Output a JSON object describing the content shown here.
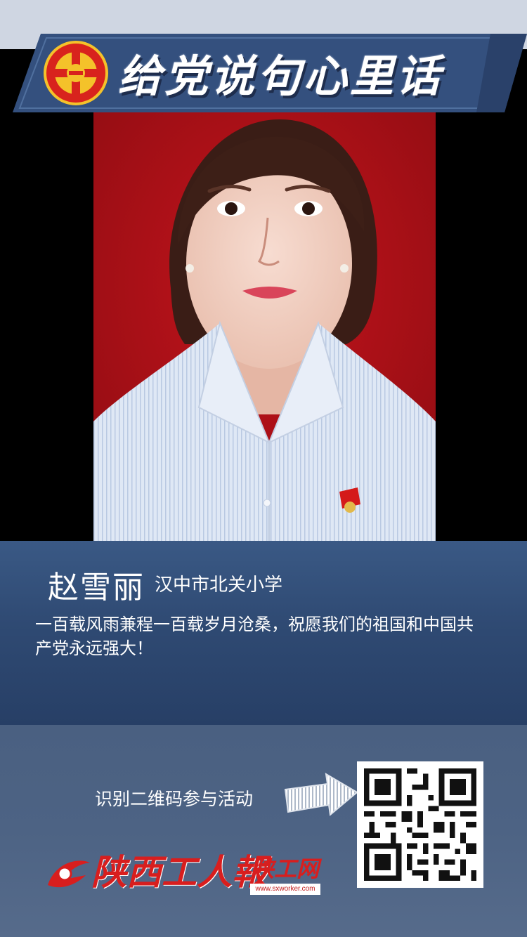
{
  "banner": {
    "title": "给党说句心里话",
    "emblem": "trade-union-emblem"
  },
  "person": {
    "name": "赵雪丽",
    "organization": "汉中市北关小学",
    "message": "一百载风雨兼程一百载岁月沧桑，祝愿我们的祖国和中国共产党永远强大！"
  },
  "footer": {
    "cta": "识别二维码参与活动",
    "newspaper": "陕西工人報",
    "website": "陕工网",
    "url": "www.sxworker.com"
  },
  "colors": {
    "banner_bg": "#34507e",
    "info_panel": "#2f4a73",
    "bottom_panel": "#4d6384",
    "brand_red": "#d81e1e",
    "photo_bg": "#b3111a"
  }
}
